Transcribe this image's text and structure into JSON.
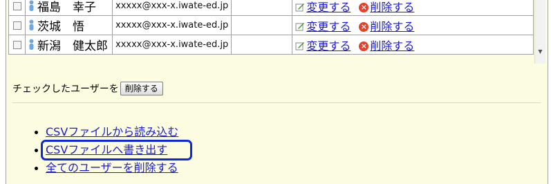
{
  "users": [
    {
      "name": "福島　幸子",
      "email": "xxxxx@xxx-x.iwate-ed.jp",
      "edit_label": "変更する",
      "delete_label": "削除する"
    },
    {
      "name": "茨城　悟",
      "email": "xxxxx@xxx-x.iwate-ed.jp",
      "edit_label": "変更する",
      "delete_label": "削除する"
    },
    {
      "name": "新潟　健太郎",
      "email": "xxxxx@xxx-x.iwate-ed.jp",
      "edit_label": "変更する",
      "delete_label": "削除する"
    }
  ],
  "bulk": {
    "prefix": "チェックしたユーザーを",
    "button_label": "削除する"
  },
  "file_links": {
    "import_label": "CSVファイルから読み込む",
    "export_label": "CSVファイルへ書き出す",
    "delete_all_label": "全てのユーザーを削除する"
  },
  "colors": {
    "panel_bg": "#fcfce0",
    "link": "#1a1ad8",
    "highlight": "#0b27e0",
    "delete_icon": "#e8402a",
    "person_icon": "#6aa9e8"
  }
}
